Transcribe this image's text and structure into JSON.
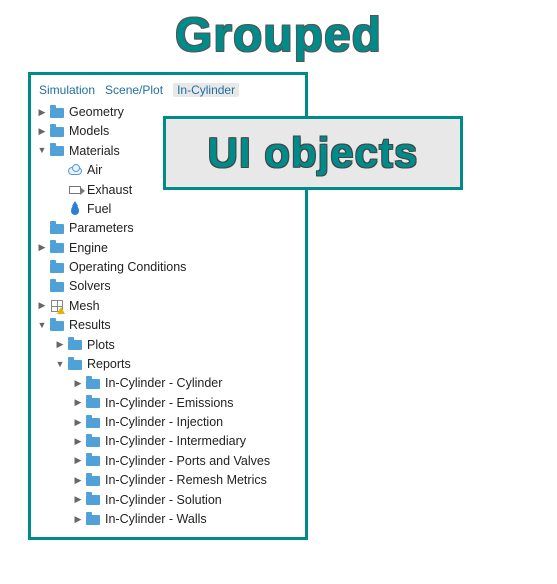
{
  "title": "Grouped",
  "callout": "UI objects",
  "tabs": [
    {
      "label": "Simulation",
      "active": false
    },
    {
      "label": "Scene/Plot",
      "active": false
    },
    {
      "label": "In-Cylinder",
      "active": true
    }
  ],
  "tree": [
    {
      "depth": 0,
      "handle": "closed",
      "icon": "folder",
      "label": "Geometry"
    },
    {
      "depth": 0,
      "handle": "closed",
      "icon": "folder",
      "label": "Models"
    },
    {
      "depth": 0,
      "handle": "open",
      "icon": "folder",
      "label": "Materials"
    },
    {
      "depth": 1,
      "handle": "none",
      "icon": "cloud",
      "label": "Air"
    },
    {
      "depth": 1,
      "handle": "none",
      "icon": "arrow",
      "label": "Exhaust"
    },
    {
      "depth": 1,
      "handle": "none",
      "icon": "drop",
      "label": "Fuel"
    },
    {
      "depth": 0,
      "handle": "none",
      "icon": "folder",
      "label": "Parameters"
    },
    {
      "depth": 0,
      "handle": "closed",
      "icon": "folder",
      "label": "Engine"
    },
    {
      "depth": 0,
      "handle": "none",
      "icon": "folder",
      "label": "Operating Conditions"
    },
    {
      "depth": 0,
      "handle": "none",
      "icon": "folder",
      "label": "Solvers"
    },
    {
      "depth": 0,
      "handle": "closed",
      "icon": "mesh",
      "label": "Mesh"
    },
    {
      "depth": 0,
      "handle": "open",
      "icon": "folder",
      "label": "Results"
    },
    {
      "depth": 1,
      "handle": "closed",
      "icon": "folder",
      "label": "Plots"
    },
    {
      "depth": 1,
      "handle": "open",
      "icon": "folder",
      "label": "Reports"
    },
    {
      "depth": 2,
      "handle": "closed",
      "icon": "folder",
      "label": "In-Cylinder - Cylinder"
    },
    {
      "depth": 2,
      "handle": "closed",
      "icon": "folder",
      "label": "In-Cylinder - Emissions"
    },
    {
      "depth": 2,
      "handle": "closed",
      "icon": "folder",
      "label": "In-Cylinder - Injection"
    },
    {
      "depth": 2,
      "handle": "closed",
      "icon": "folder",
      "label": "In-Cylinder - Intermediary"
    },
    {
      "depth": 2,
      "handle": "closed",
      "icon": "folder",
      "label": "In-Cylinder - Ports and Valves"
    },
    {
      "depth": 2,
      "handle": "closed",
      "icon": "folder",
      "label": "In-Cylinder - Remesh Metrics"
    },
    {
      "depth": 2,
      "handle": "closed",
      "icon": "folder",
      "label": "In-Cylinder - Solution"
    },
    {
      "depth": 2,
      "handle": "closed",
      "icon": "folder",
      "label": "In-Cylinder - Walls"
    }
  ]
}
